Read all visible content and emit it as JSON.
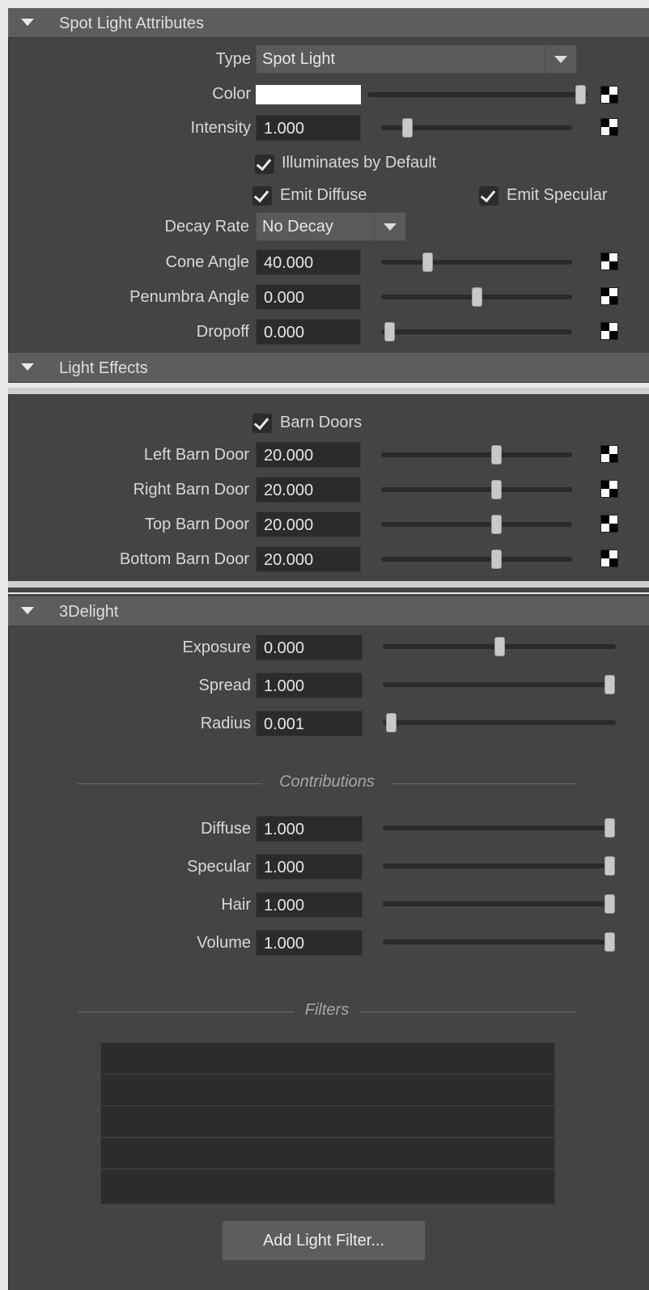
{
  "sections": {
    "spot": {
      "title": "Spot Light Attributes"
    },
    "effects": {
      "title": "Light Effects"
    },
    "delight": {
      "title": "3Delight"
    }
  },
  "spot": {
    "type_label": "Type",
    "type_value": "Spot Light",
    "color_label": "Color",
    "color_value": "#ffffff",
    "color_slider": 1.0,
    "intensity_label": "Intensity",
    "intensity_value": "1.000",
    "intensity_slider": 0.13,
    "illuminates_label": "Illuminates by Default",
    "illuminates_checked": true,
    "emit_diffuse_label": "Emit Diffuse",
    "emit_diffuse_checked": true,
    "emit_specular_label": "Emit Specular",
    "emit_specular_checked": true,
    "decay_label": "Decay Rate",
    "decay_value": "No Decay",
    "cone_label": "Cone Angle",
    "cone_value": "40.000",
    "cone_slider": 0.25,
    "penumbra_label": "Penumbra Angle",
    "penumbra_value": "0.000",
    "penumbra_slider": 0.5,
    "dropoff_label": "Dropoff",
    "dropoff_value": "0.000",
    "dropoff_slider": 0.0
  },
  "effects": {
    "barn_doors_label": "Barn Doors",
    "barn_doors_checked": true,
    "left_label": "Left Barn Door",
    "left_value": "20.000",
    "right_label": "Right Barn Door",
    "right_value": "20.000",
    "top_label": "Top Barn Door",
    "top_value": "20.000",
    "bottom_label": "Bottom Barn Door",
    "bottom_value": "20.000"
  },
  "delight": {
    "exposure_label": "Exposure",
    "exposure_value": "0.000",
    "spread_label": "Spread",
    "spread_value": "1.000",
    "radius_label": "Radius",
    "radius_value": "0.001",
    "contributions_title": "Contributions",
    "diffuse_label": "Diffuse",
    "diffuse_value": "1.000",
    "specular_label": "Specular",
    "specular_value": "1.000",
    "hair_label": "Hair",
    "hair_value": "1.000",
    "volume_label": "Volume",
    "volume_value": "1.000",
    "filters_title": "Filters",
    "add_filter_label": "Add Light Filter..."
  },
  "icons": {
    "section_toggle": "triangle-down-icon",
    "map_button": "checker-map-icon",
    "checkbox": "checkmark-icon",
    "dropdown": "chevron-down-icon"
  }
}
